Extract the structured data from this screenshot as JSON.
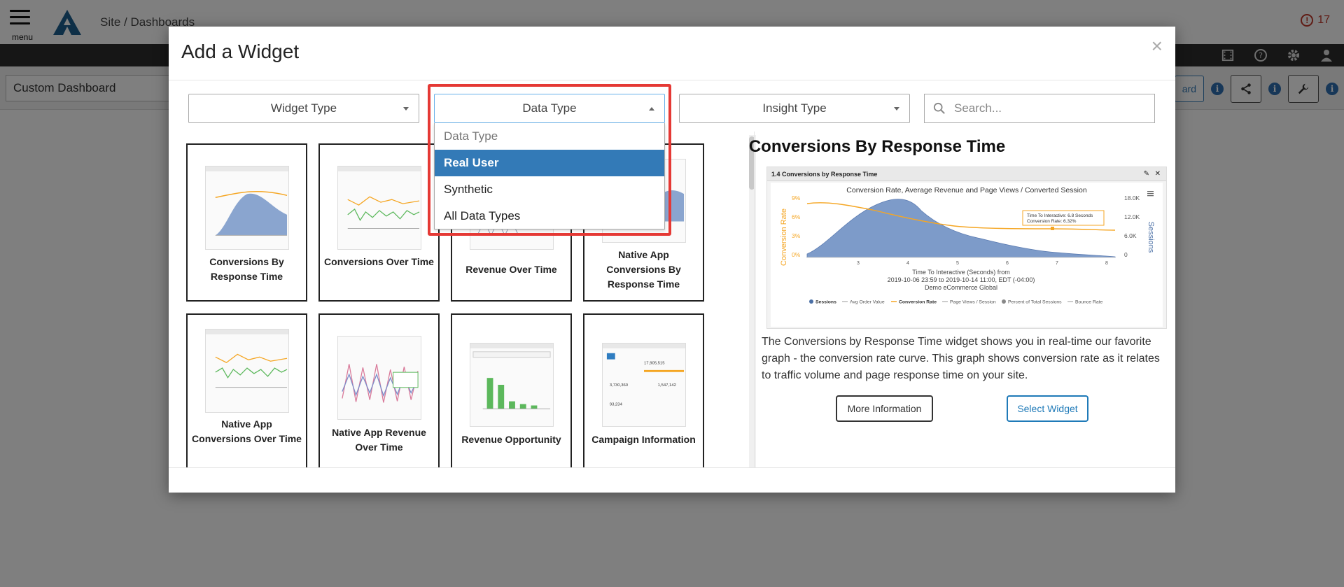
{
  "app": {
    "menu_label": "menu",
    "breadcrumb": "Site / Dashboards",
    "alert_count": "17",
    "dashboard_name": "Custom Dashboard",
    "toolbar_button_partial": "ard"
  },
  "modal": {
    "title": "Add a Widget",
    "close_symbol": "×",
    "filters": {
      "widget_type": "Widget Type",
      "data_type": "Data Type",
      "insight_type": "Insight Type",
      "search_placeholder": "Search..."
    },
    "data_type_options": [
      {
        "label": "Data Type",
        "placeholder": true
      },
      {
        "label": "Real User",
        "selected": true
      },
      {
        "label": "Synthetic"
      },
      {
        "label": "All Data Types"
      }
    ],
    "widgets": [
      {
        "label": "Conversions By Response Time"
      },
      {
        "label": "Conversions Over Time"
      },
      {
        "label": "Revenue Over Time"
      },
      {
        "label": "Native App Conversions By Response Time"
      },
      {
        "label": "Native App Conversions Over Time"
      },
      {
        "label": "Native App Revenue Over Time"
      },
      {
        "label": "Revenue Opportunity"
      },
      {
        "label": "Campaign Information"
      }
    ],
    "preview": {
      "title": "Conversions By Response Time",
      "panel_header": "1.4 Conversions by Response Time",
      "chart_title": "Conversion Rate, Average Revenue and Page Views / Converted Session",
      "y_left_label": "Conversion Rate",
      "y_right_label": "Sessions",
      "y_left_ticks": [
        "9%",
        "6%",
        "3%",
        "0%"
      ],
      "y_right_ticks": [
        "18.0K",
        "12.0K",
        "6.0K",
        "0"
      ],
      "x_ticks": [
        "3",
        "4",
        "5",
        "6",
        "7",
        "8"
      ],
      "x_title": "Time To Interactive (Seconds) from",
      "x_subtitle": "2019-10-06 23:59 to 2019-10-14 11:00, EDT (-04:00)",
      "x_site": "Demo eCommerce Global",
      "tooltip_line1": "Time To Interactive: 6.8 Seconds",
      "tooltip_line2": "Conversion Rate: 6.32%",
      "legend": [
        "Sessions",
        "Avg Order Value",
        "Conversion Rate",
        "Page Views / Session",
        "Percent of Total Sessions",
        "Bounce Rate"
      ],
      "description": "The Conversions by Response Time widget shows you in real-time our favorite graph - the conversion rate curve. This graph shows conversion rate as it relates to traffic volume and page response time on your site.",
      "more_info_label": "More Information",
      "select_label": "Select Widget"
    }
  },
  "colors": {
    "accent": "#337ab7",
    "highlight": "#e53935",
    "sessions_fill": "#7d9bc9",
    "conversion_line": "#f5a623"
  }
}
